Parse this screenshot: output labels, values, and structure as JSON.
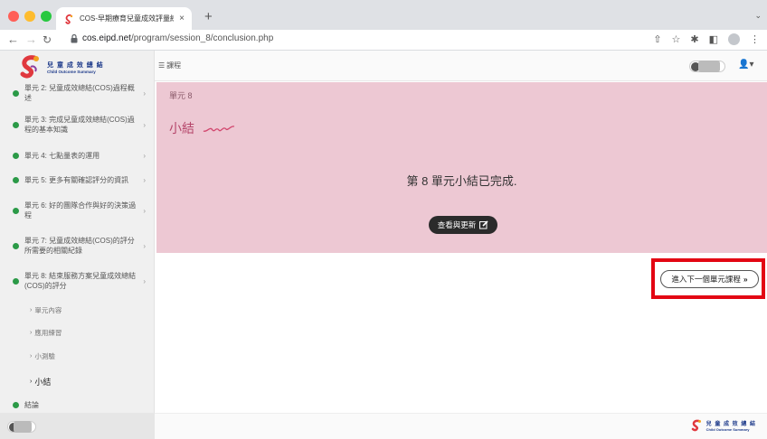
{
  "browser": {
    "tab_title": "COS-早期療育兒童成效評量線上",
    "tab_close": "×",
    "new_tab": "+",
    "tab_menu": "⌄",
    "url_host": "cos.eipd.net",
    "url_path": "/program/session_8/conclusion.php"
  },
  "logo": {
    "main": "兒 童 成 效 總 結",
    "sub": "Child Outcome Summary"
  },
  "topbar": {
    "menu_label": "課程",
    "user_caret": "▾"
  },
  "sidebar": {
    "items": [
      {
        "label": "單元 2: 兒童成效總結(COS)過程概述"
      },
      {
        "label": "單元 3: 完成兒童成效總結(COS)過程的基本知識"
      },
      {
        "label": "單元 4: 七點量表的運用"
      },
      {
        "label": "單元 5: 更多有關確認評分的資訊"
      },
      {
        "label": "單元 6: 好的團隊合作與好的決策過程"
      },
      {
        "label": "單元 7: 兒童成效總結(COS)的評分所需要的相關紀錄"
      },
      {
        "label": "單元 8: 結束服務方案兒童成效總結(COS)的評分"
      }
    ],
    "sub_items": [
      {
        "label": "單元內容"
      },
      {
        "label": "應用練習"
      },
      {
        "label": "小測驗"
      },
      {
        "label": "小結"
      }
    ],
    "conclusion": "結論"
  },
  "main": {
    "unit_label": "單元 8",
    "section_title": "小結",
    "complete_message": "第 8 單元小結已完成.",
    "review_button": "查看與更新",
    "next_button": "進入下一個單元課程",
    "next_icon": "»"
  },
  "colors": {
    "banner": "#edc8d3",
    "accent_pink": "#b5466a",
    "complete_dot": "#2b9a47",
    "highlight": "#e30613"
  }
}
